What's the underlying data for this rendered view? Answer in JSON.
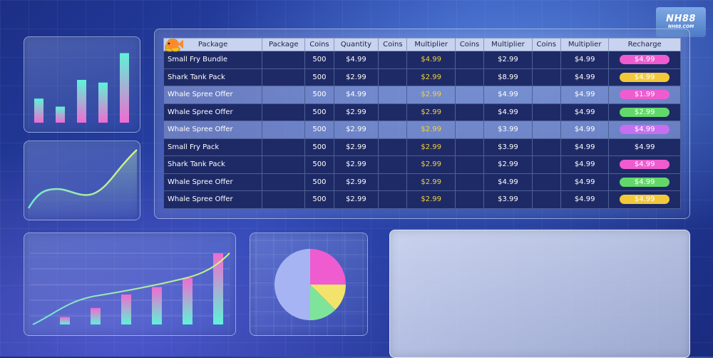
{
  "logo": {
    "line1": "NH88",
    "line2": "NH88.COM"
  },
  "table": {
    "headers": [
      "Package",
      "Package",
      "Coins",
      "Quantity",
      "Coins",
      "Multiplier",
      "Coins",
      "Multiplier",
      "Coins",
      "Multiplier",
      "Recharge"
    ],
    "rows": [
      {
        "name": "Small Fry Bundle",
        "fish": "blue",
        "coins": "500",
        "quantity": "$4.99",
        "mult1": "$4.99",
        "mult2": "$2.99",
        "fish2": "orange",
        "mult3": "$4.99",
        "recharge": "$4.99",
        "recharge_color": "#ee5ccf",
        "style": "dark"
      },
      {
        "name": "Shark Tank Pack",
        "fish": "blue",
        "coins": "500",
        "quantity": "$2.99",
        "mult1": "$2.99",
        "mult2": "$8.99",
        "fish2": "orange",
        "mult3": "$4.99",
        "recharge": "$4.99",
        "recharge_color": "#f3c93a",
        "style": "dark"
      },
      {
        "name": "Whale Spree Offer",
        "fish": "blue",
        "coins": "500",
        "quantity": "$4.99",
        "mult1": "$2.99",
        "mult2": "$4.99",
        "fish2": "orange",
        "mult3": "$4.99",
        "recharge": "$1.99",
        "recharge_color": "#ee5ccf",
        "style": "light"
      },
      {
        "name": "Whale Spree Offer",
        "fish": "blue",
        "coins": "500",
        "quantity": "$2.99",
        "mult1": "$2.99",
        "mult2": "$4.99",
        "fish2": "orange",
        "mult3": "$4.99",
        "recharge": "$2.99",
        "recharge_color": "#63d86a",
        "style": "dark"
      },
      {
        "name": "Whale Spree Offer",
        "fish": "blue",
        "coins": "500",
        "quantity": "$2.99",
        "mult1": "$2.99",
        "mult2": "$3.99",
        "fish2": "orange",
        "mult3": "$4.99",
        "recharge": "$4.99",
        "recharge_color": "#c86ef0",
        "style": "light"
      },
      {
        "name": "Small Fry Pack",
        "fish": "pink",
        "coins": "500",
        "quantity": "$2.99",
        "mult1": "$2.99",
        "mult2": "$3.99",
        "fish2": "orange",
        "mult3": "$4.99",
        "recharge": "$4.99",
        "recharge_color": "",
        "style": "dark"
      },
      {
        "name": "Shark Tank Pack",
        "fish": "blue",
        "coins": "500",
        "quantity": "$2.99",
        "mult1": "$2.99",
        "mult2": "$2.99",
        "fish2": "orange",
        "mult3": "$4.99",
        "recharge": "$4.99",
        "recharge_color": "#ee5ccf",
        "style": "dark"
      },
      {
        "name": "Whale Spree Offer",
        "fish": "blue",
        "coins": "500",
        "quantity": "$2.99",
        "mult1": "$2.99",
        "mult2": "$4.99",
        "fish2": "orange",
        "mult3": "$4.99",
        "recharge": "$4.99",
        "recharge_color": "#63d86a",
        "style": "dark"
      },
      {
        "name": "Whale Spree Offer",
        "fish": "orange",
        "coins": "500",
        "quantity": "$2.99",
        "mult1": "$2.99",
        "mult2": "$3.99",
        "fish2": "orange",
        "mult3": "$4.99",
        "recharge": "$4.99",
        "recharge_color": "#f3c93a",
        "style": "dark"
      }
    ]
  },
  "charts": {
    "bar_small": [
      0.45,
      0.3,
      0.8,
      0.75,
      1.3
    ],
    "bar_large": [
      0.1,
      0.22,
      0.4,
      0.5,
      0.62,
      0.95
    ],
    "pie": [
      {
        "value": 0.25,
        "color": "#ee5ccf"
      },
      {
        "value": 0.125,
        "color": "#f3e36a"
      },
      {
        "value": 0.125,
        "color": "#7ee49a"
      },
      {
        "value": 0.5,
        "color": "#a7b4f4"
      }
    ]
  },
  "colors": {
    "fish_blue": "#37b7f0",
    "fish_pink": "#f06bd0",
    "fish_orange": "#ff8a2a",
    "coin": "#f2c12e",
    "accent_cyan": "#5ff2d8",
    "accent_pink": "#f06bd0"
  }
}
